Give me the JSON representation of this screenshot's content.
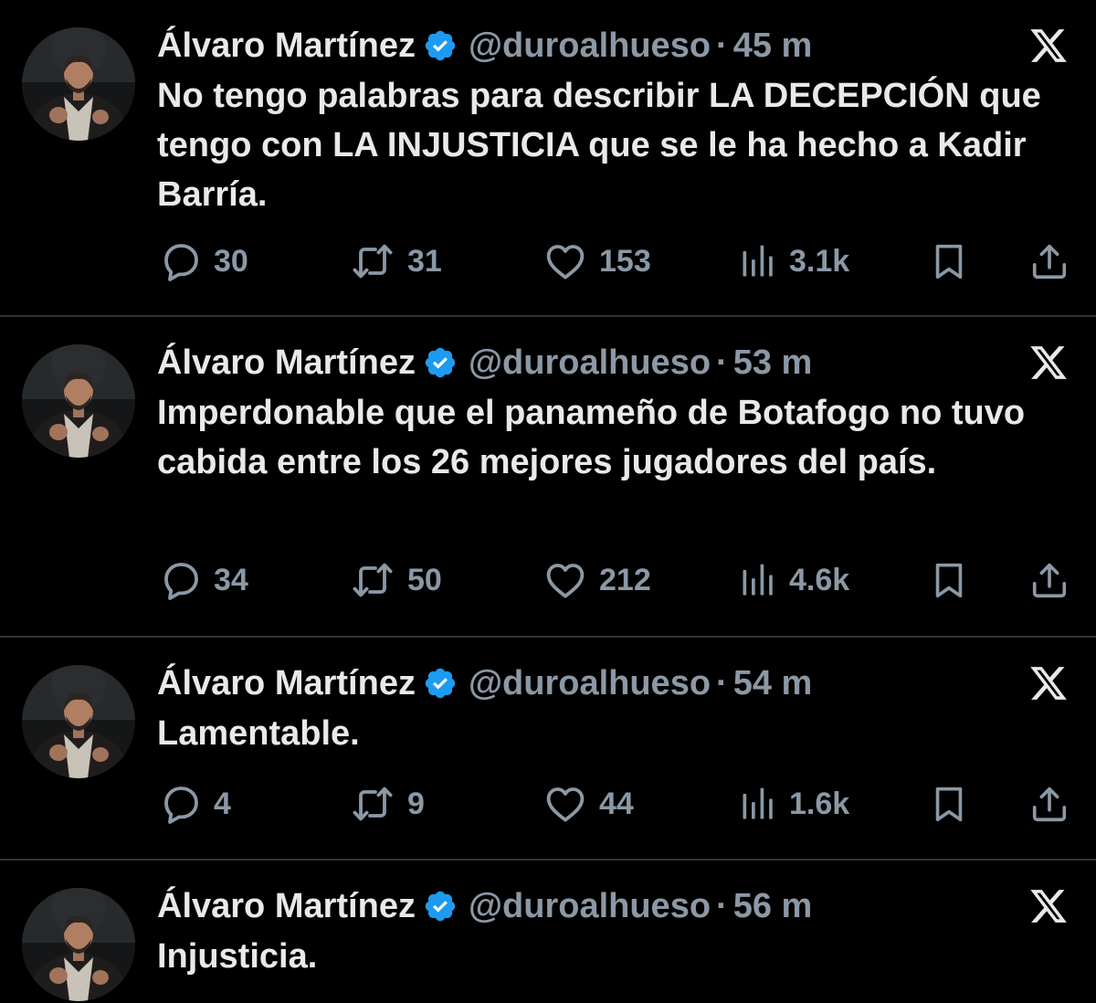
{
  "colors": {
    "background": "#000000",
    "primary_text": "#e7e9ea",
    "secondary_text": "#8b98a5",
    "verified_blue": "#1d9bf0",
    "divider": "#2f3336"
  },
  "icons": {
    "verified": "verified-badge-icon",
    "x_logo": "x-logo-icon",
    "reply": "reply-bubble-icon",
    "retweet": "retweet-icon",
    "like": "heart-icon",
    "views": "views-bar-chart-icon",
    "bookmark": "bookmark-icon",
    "share": "share-upload-icon"
  },
  "tweets": [
    {
      "author": "Álvaro Martínez",
      "handle": "@duroalhueso",
      "dot": "·",
      "time": "45 m",
      "text": "No tengo palabras para describir LA DECEPCIÓN que tengo con LA INJUSTICIA que se le ha hecho a Kadir Barría.",
      "replies": "30",
      "retweets": "31",
      "likes": "153",
      "views": "3.1k"
    },
    {
      "author": "Álvaro Martínez",
      "handle": "@duroalhueso",
      "dot": "·",
      "time": "53 m",
      "text": "Imperdonable que el panameño de Botafogo no tuvo cabida entre los 26 mejores jugadores del país.",
      "replies": "34",
      "retweets": "50",
      "likes": "212",
      "views": "4.6k"
    },
    {
      "author": "Álvaro Martínez",
      "handle": "@duroalhueso",
      "dot": "·",
      "time": "54 m",
      "text": "Lamentable.",
      "replies": "4",
      "retweets": "9",
      "likes": "44",
      "views": "1.6k"
    },
    {
      "author": "Álvaro Martínez",
      "handle": "@duroalhueso",
      "dot": "·",
      "time": "56 m",
      "text": "Injusticia."
    }
  ]
}
